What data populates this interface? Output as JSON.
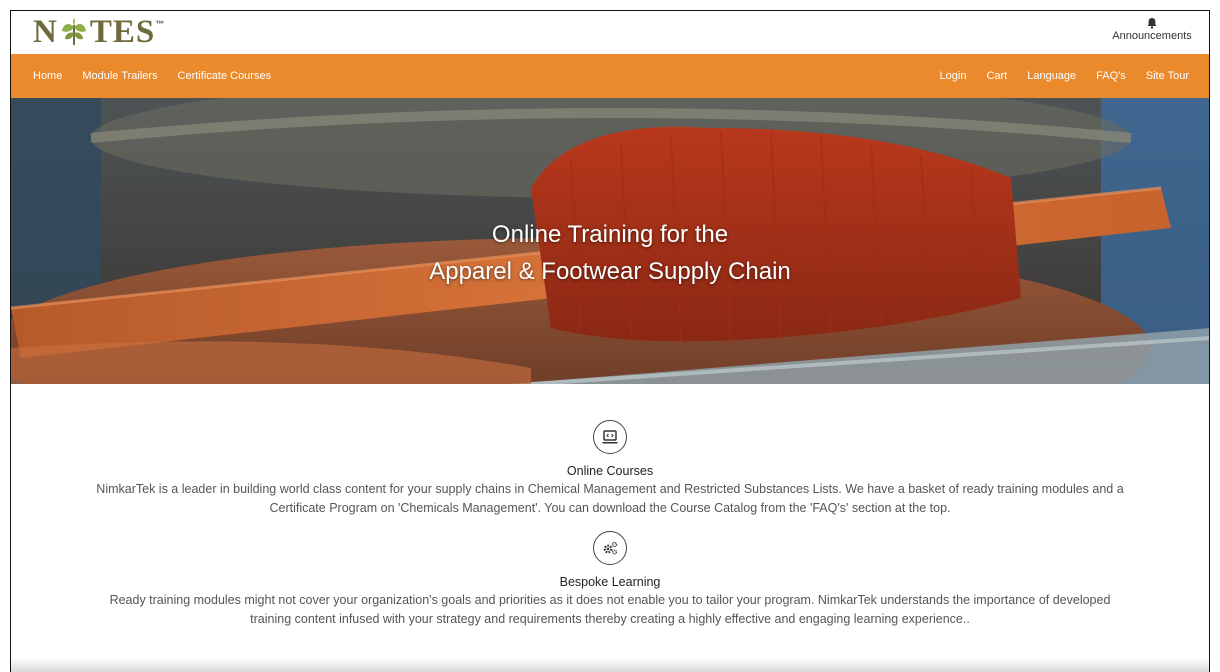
{
  "header": {
    "logo_text_left": "N",
    "logo_text_right": "TES",
    "logo_tm": "™",
    "announcements_label": "Announcements"
  },
  "nav": {
    "left": [
      "Home",
      "Module Trailers",
      "Certificate Courses"
    ],
    "right": [
      "Login",
      "Cart",
      "Language",
      "FAQ's",
      "Site Tour"
    ]
  },
  "hero": {
    "line1": "Online Training for the",
    "line2": "Apparel & Footwear Supply Chain"
  },
  "features": [
    {
      "icon": "laptop-code-icon",
      "title": "Online Courses",
      "text": "NimkarTek is a leader in building world class content for your supply chains in Chemical Management and Restricted Substances Lists. We have a basket of ready training modules and a Certificate Program on 'Chemicals Management'. You can download the Course Catalog from the 'FAQ's' section at the top."
    },
    {
      "icon": "gears-icon",
      "title": "Bespoke Learning",
      "text": "Ready training modules might not cover your organization's goals and priorities as it does not enable you to tailor your program. NimkarTek understands the importance of developed training content infused with your strategy and requirements thereby creating a highly effective and engaging learning experience.."
    }
  ],
  "colors": {
    "nav_bg": "#ea8a2c",
    "logo": "#6f6a3c",
    "leaf": "#8db04a"
  }
}
